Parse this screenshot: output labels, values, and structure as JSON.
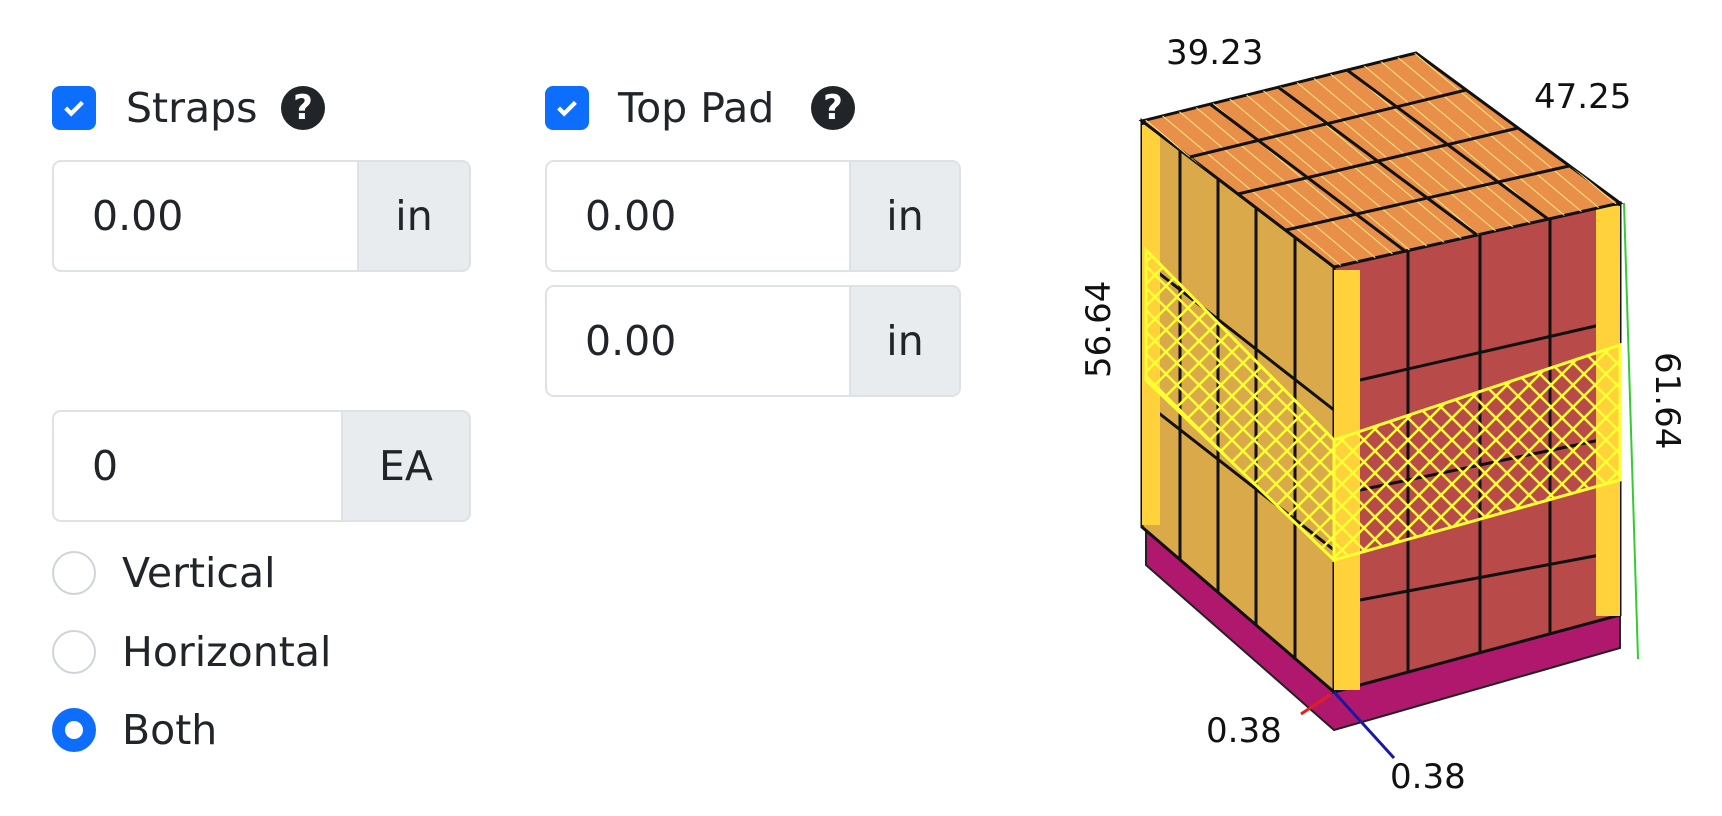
{
  "straps": {
    "label": "Straps",
    "checked": true,
    "help_icon": "question-circle-icon",
    "width_value": "0.00",
    "width_unit": "in",
    "count_value": "0",
    "count_unit": "EA",
    "orientation": {
      "options": [
        "Vertical",
        "Horizontal",
        "Both"
      ],
      "selected": "Both"
    }
  },
  "top_pad": {
    "label": "Top Pad",
    "checked": true,
    "help_icon": "question-circle-icon",
    "value1": "0.00",
    "unit1": "in",
    "value2": "0.00",
    "unit2": "in"
  },
  "preview": {
    "width": "39.23",
    "depth": "47.25",
    "load_height": "56.64",
    "total_height": "61.64",
    "overhang_x": "0.38",
    "overhang_y": "0.38"
  },
  "colors": {
    "accent": "#0d6efd",
    "strap": "#ffff33",
    "carton_top": "#e8904a",
    "carton_side": "#b84a4a",
    "pallet": "#b0186e"
  }
}
